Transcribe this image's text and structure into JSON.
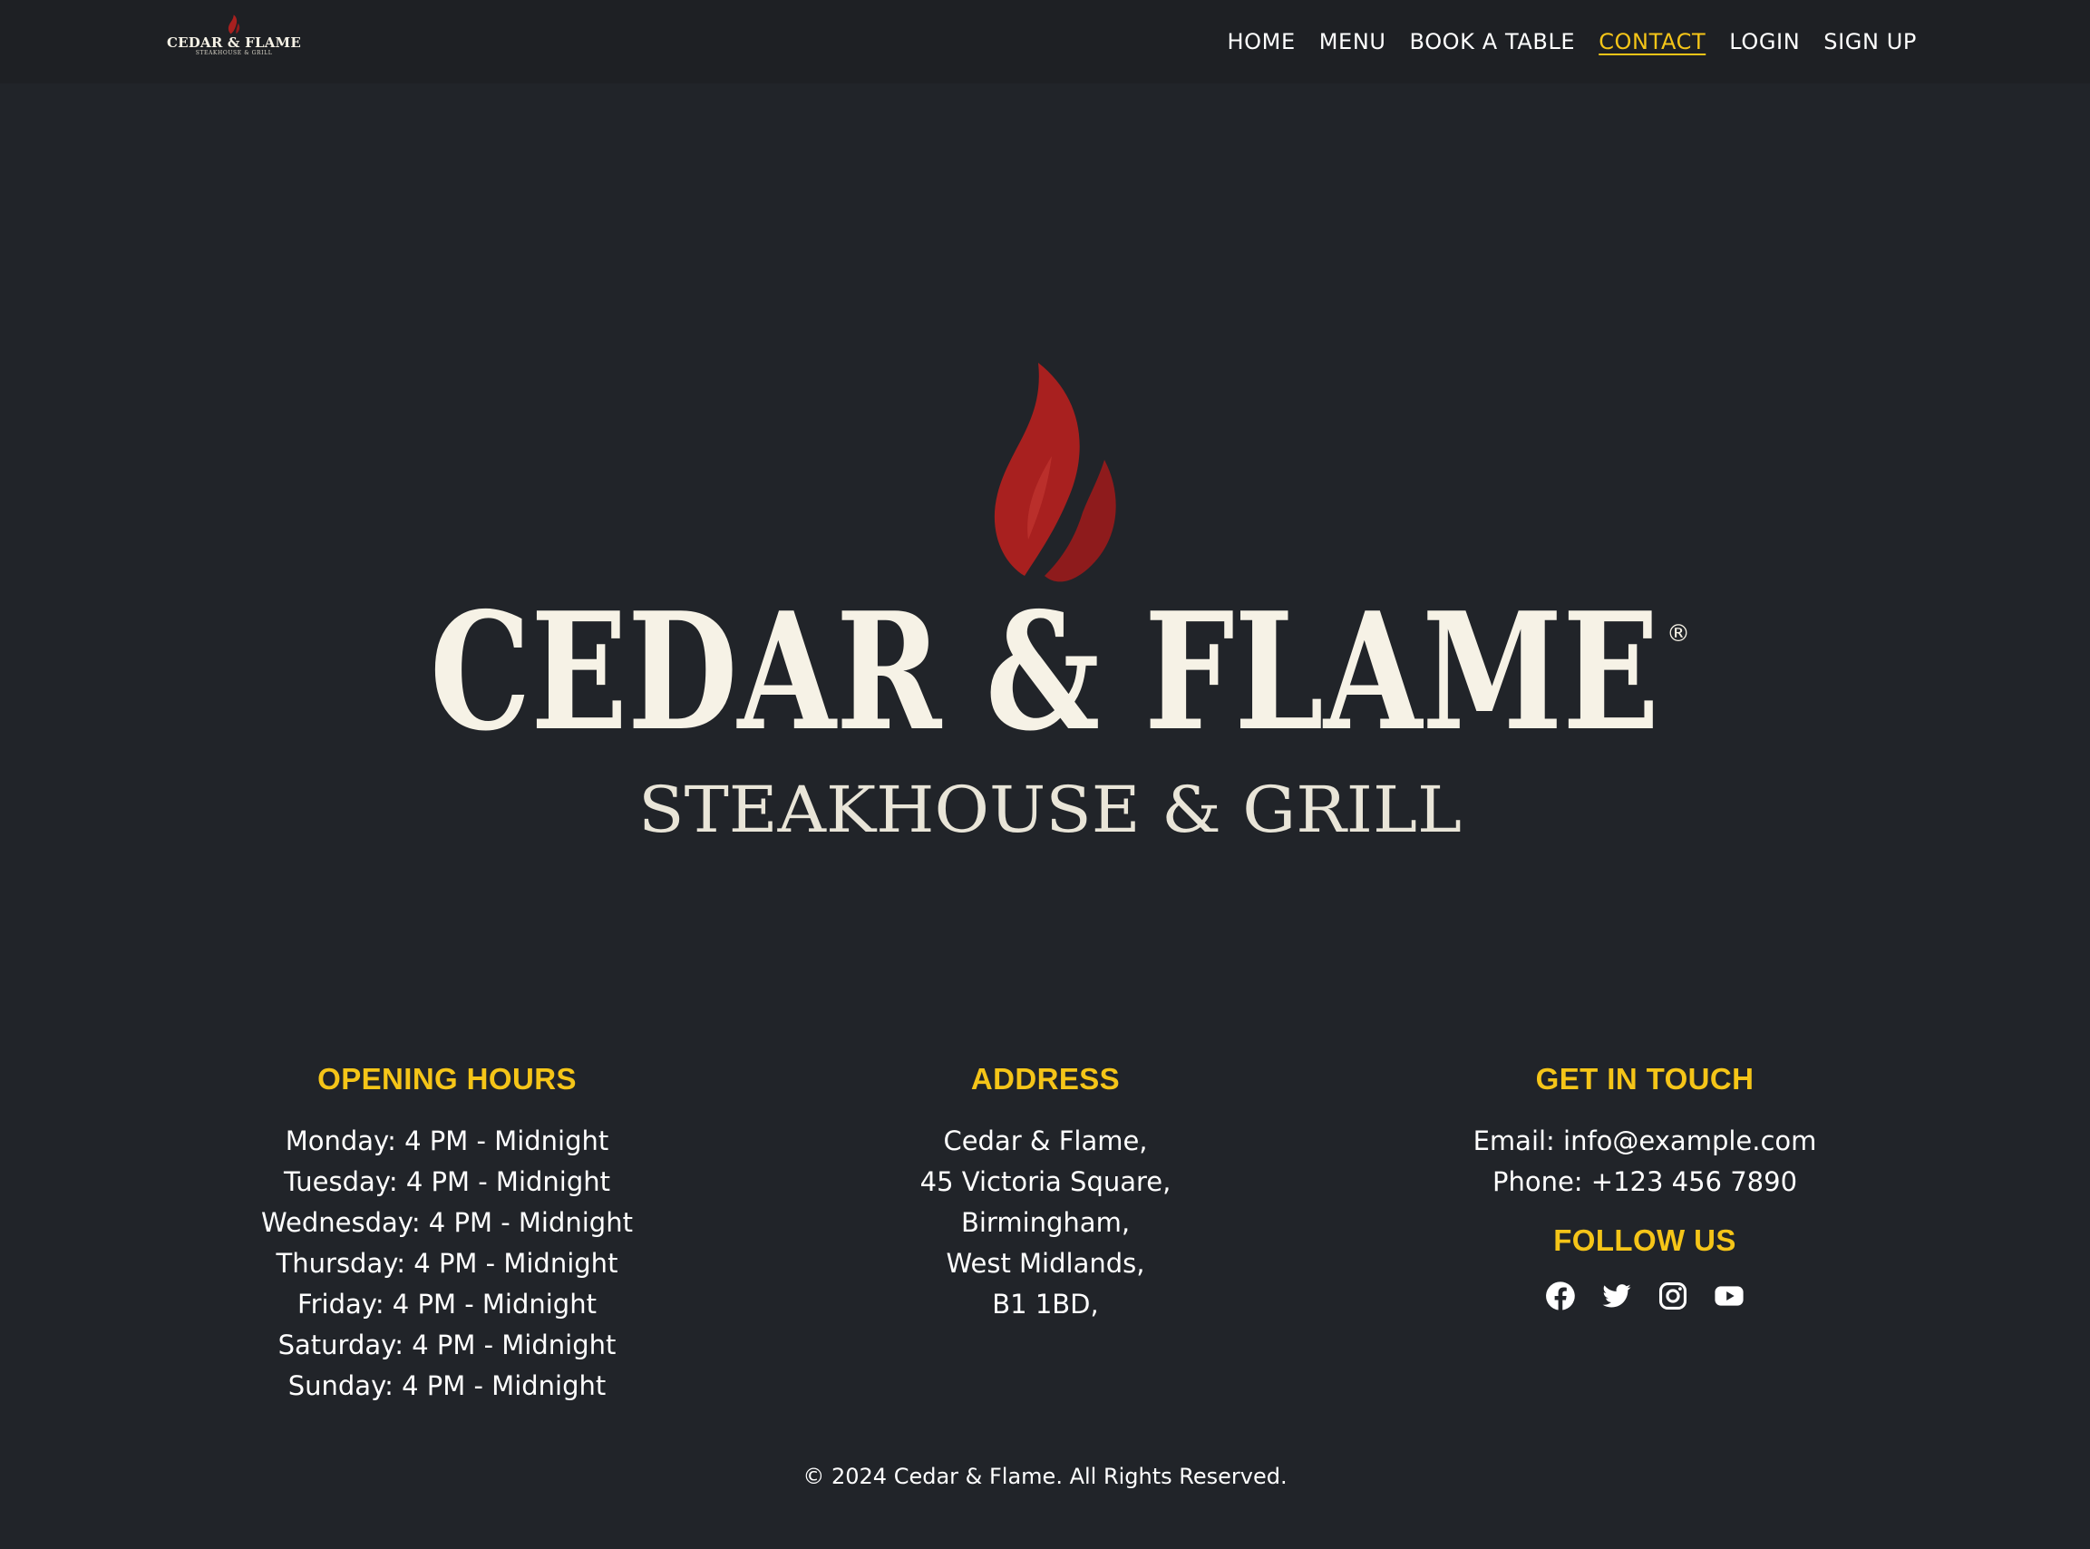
{
  "brand": {
    "title": "CEDAR & FLAME",
    "subtitle": "STEAKHOUSE & GRILL",
    "trademark": "®",
    "flame_color": "#a8201f",
    "text_color": "#f6f2e6"
  },
  "nav": {
    "items": [
      {
        "label": "HOME",
        "active": false
      },
      {
        "label": "MENU",
        "active": false
      },
      {
        "label": "BOOK A TABLE",
        "active": false
      },
      {
        "label": "CONTACT",
        "active": true
      },
      {
        "label": "LOGIN",
        "active": false
      },
      {
        "label": "SIGN UP",
        "active": false
      }
    ]
  },
  "opening_hours": {
    "heading": "OPENING HOURS",
    "lines": [
      "Monday: 4 PM - Midnight",
      "Tuesday: 4 PM - Midnight",
      "Wednesday: 4 PM - Midnight",
      "Thursday: 4 PM - Midnight",
      "Friday: 4 PM - Midnight",
      "Saturday: 4 PM - Midnight",
      "Sunday: 4 PM - Midnight"
    ]
  },
  "address": {
    "heading": "ADDRESS",
    "lines": [
      "Cedar & Flame,",
      "45 Victoria Square,",
      "Birmingham,",
      "West Midlands,",
      "B1 1BD,"
    ]
  },
  "contact": {
    "heading": "GET IN TOUCH",
    "email": "Email: info@example.com",
    "phone": "Phone: +123 456 7890",
    "follow_heading": "FOLLOW US",
    "social": [
      "facebook-icon",
      "twitter-icon",
      "instagram-icon",
      "youtube-icon"
    ]
  },
  "footer": {
    "copyright": "© 2024 Cedar & Flame. All Rights Reserved."
  },
  "colors": {
    "background": "#212429",
    "accent": "#f5c518",
    "text": "#ffffff"
  }
}
